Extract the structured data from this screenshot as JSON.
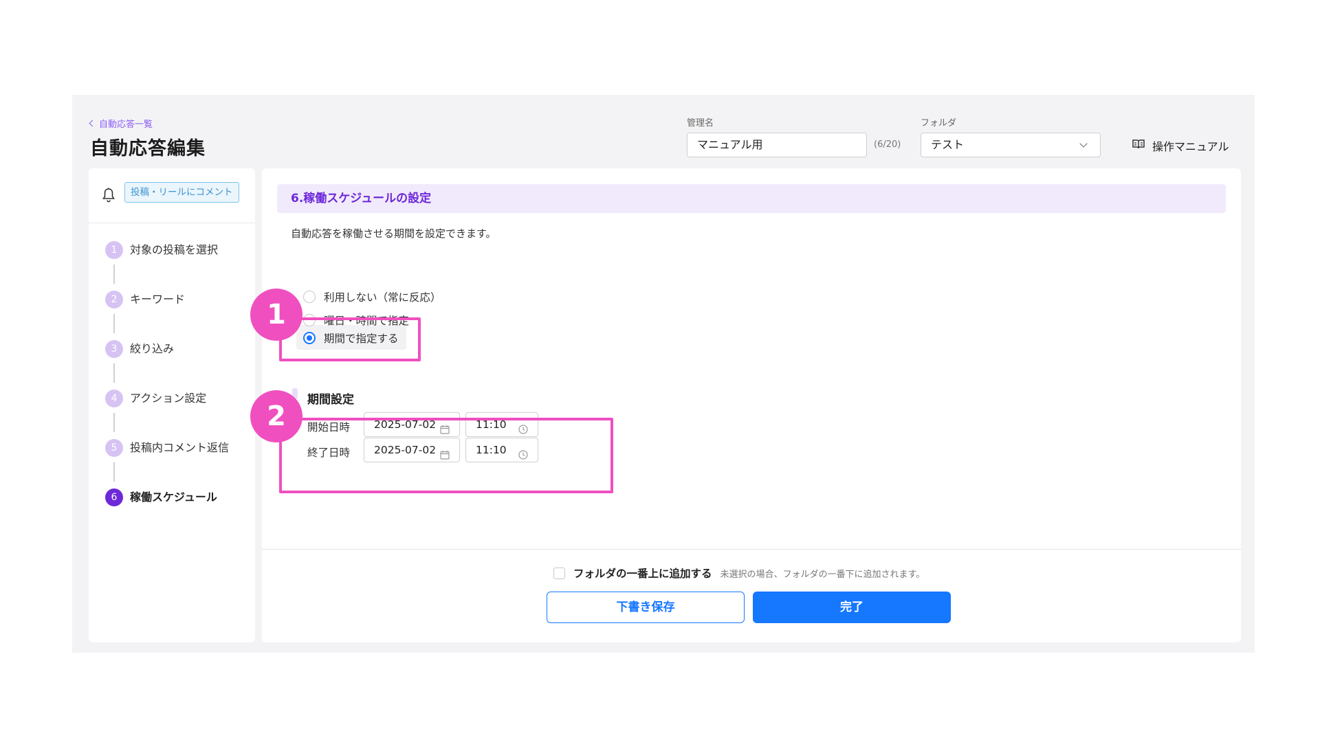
{
  "header": {
    "back_label": "自動応答一覧",
    "title": "自動応答編集",
    "name_label": "管理名",
    "name_value": "マニュアル用",
    "name_counter": "(6/20)",
    "folder_label": "フォルダ",
    "folder_value": "テスト",
    "manual_label": "操作マニュアル"
  },
  "sidebar": {
    "trigger_badge": "投稿・リールにコメント",
    "steps": [
      {
        "num": "1",
        "label": "対象の投稿を選択"
      },
      {
        "num": "2",
        "label": "キーワード"
      },
      {
        "num": "3",
        "label": "絞り込み"
      },
      {
        "num": "4",
        "label": "アクション設定"
      },
      {
        "num": "5",
        "label": "投稿内コメント返信"
      },
      {
        "num": "6",
        "label": "稼働スケジュール"
      }
    ],
    "active_step": "6"
  },
  "main": {
    "section_title": "6.稼働スケジュールの設定",
    "description": "自動応答を稼働させる期間を設定できます。",
    "options": [
      {
        "label": "利用しない（常に反応）",
        "checked": false
      },
      {
        "label": "曜日・時間で指定",
        "checked": false
      },
      {
        "label": "期間で指定する",
        "checked": true
      }
    ],
    "period": {
      "title": "期間設定",
      "start_label": "開始日時",
      "start_date": "2025-07-02",
      "start_time": "11:10",
      "end_label": "終了日時",
      "end_date": "2025-07-02",
      "end_time": "11:10"
    }
  },
  "footer": {
    "checkbox_label": "フォルダの一番上に追加する",
    "checkbox_checked": false,
    "checkbox_note": "未選択の場合、フォルダの一番下に追加されます。",
    "draft_button": "下書き保存",
    "done_button": "完了"
  },
  "annotations": {
    "badge_1": "1",
    "badge_2": "2"
  },
  "colors": {
    "accent_purple": "#6d28d9",
    "primary_blue": "#1677ff",
    "highlight_pink": "#f04fc0",
    "section_bg": "#f1eafc"
  }
}
